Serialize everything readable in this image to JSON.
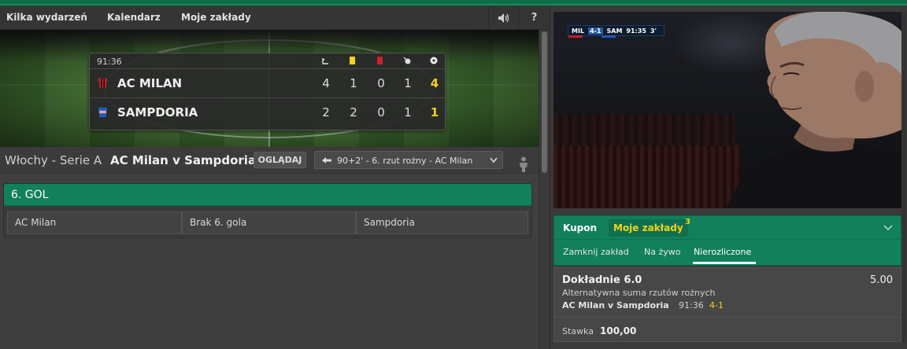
{
  "nav": {
    "items": [
      "Kilka wydarzeń",
      "Kalendarz",
      "Moje zakłady"
    ],
    "sound_icon": "speaker-icon",
    "help_label": "?"
  },
  "scoreboard": {
    "time": "91:36",
    "columns": [
      "corner-icon",
      "yellow-card-icon",
      "red-card-icon",
      "penalty-icon",
      "goal-icon"
    ],
    "teams": [
      {
        "name": "AC MILAN",
        "stats": [
          "4",
          "1",
          "0",
          "1"
        ],
        "score": "4",
        "shirt_color": "#c0202a"
      },
      {
        "name": "SAMPDORIA",
        "stats": [
          "2",
          "2",
          "0",
          "1"
        ],
        "score": "1",
        "shirt_color": "#2159b7"
      }
    ]
  },
  "event": {
    "league": "Włochy - Serie A",
    "match": "AC Milan v Sampdoria",
    "watch_label": "OGLĄDAJ",
    "incident": "90+2' - 6. rzut rożny - AC Milan"
  },
  "market": {
    "title": "6. GOL",
    "outcomes": [
      "AC Milan",
      "Brak 6. gola",
      "Sampdoria"
    ]
  },
  "video": {
    "tv_home": "MIL",
    "tv_result": "4-1",
    "tv_away": "SAM",
    "tv_time": "91:35",
    "tv_extra": "3'"
  },
  "coupon": {
    "tab_coupon": "Kupon",
    "tab_my_bets": "Moje zakłady",
    "my_bets_count": "3",
    "subtabs": [
      "Zamknij zakład",
      "Na żywo",
      "Nierozliczone"
    ],
    "active_subtab": "Nierozliczone"
  },
  "bet": {
    "selection": "Dokładnie  6.0",
    "odds": "5.00",
    "market": "Alternatywna suma rzutów rożnych",
    "event": "AC Milan v Sampdoria",
    "time": "91:36",
    "score": "4-1",
    "stake_label": "Stawka",
    "stake_value": "100,00"
  },
  "colors": {
    "accent_green": "#12805a",
    "highlight_yellow": "#f2d21b",
    "milan_red": "#c0202a",
    "sampdoria_blue": "#2159b7"
  }
}
